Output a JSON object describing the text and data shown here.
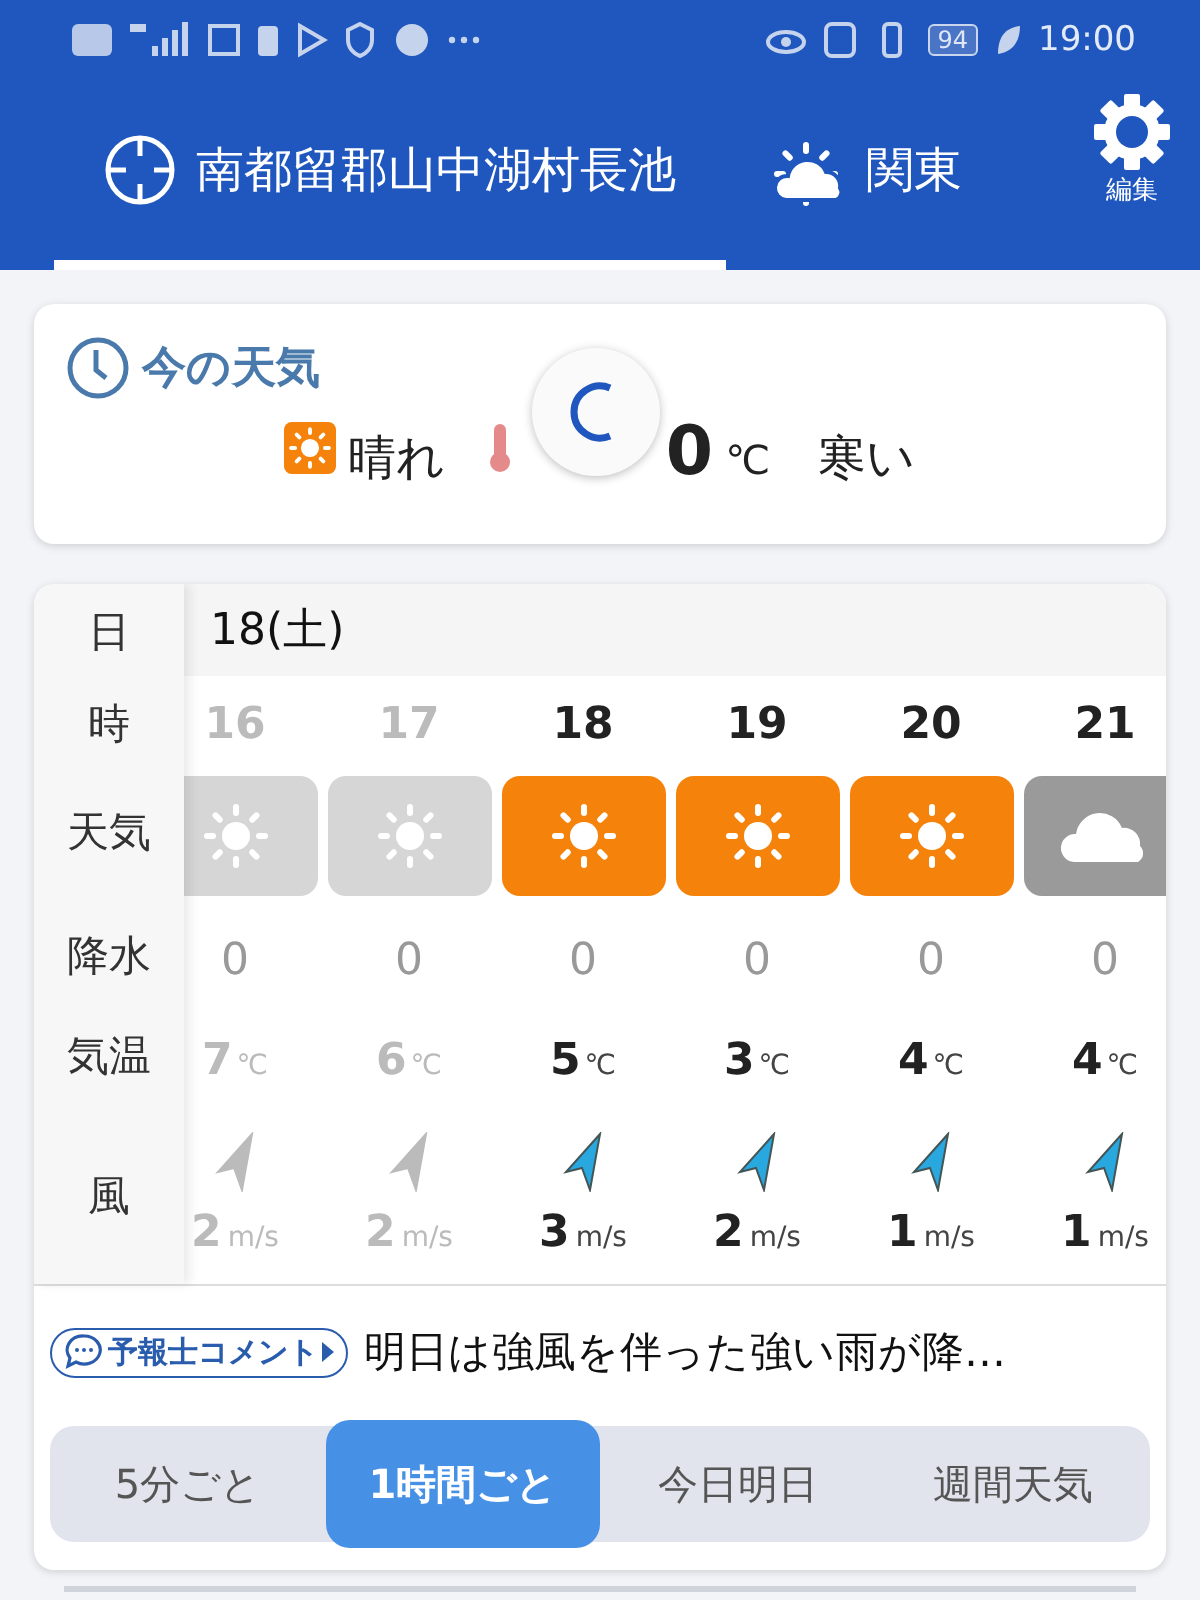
{
  "status_bar": {
    "battery": "94",
    "time": "19:00"
  },
  "header": {
    "tabs": [
      {
        "kind": "location",
        "label": "南都留郡山中湖村長池",
        "selected": true
      },
      {
        "kind": "region",
        "label": "関東",
        "selected": false
      }
    ],
    "settings_label": "編集"
  },
  "current": {
    "title": "今の天気",
    "condition": "晴れ",
    "temperature": "0",
    "unit": "℃",
    "feeling": "寒い",
    "loading": true
  },
  "hourly": {
    "row_labels": [
      "日",
      "時",
      "天気",
      "降水",
      "気温",
      "風"
    ],
    "date": "18(土)",
    "columns": [
      {
        "hour": "16",
        "past": true,
        "kind": "sunny",
        "precip": "0",
        "temp": "7",
        "temp_unit": "℃",
        "wind": "2",
        "wind_unit": "m/s"
      },
      {
        "hour": "17",
        "past": true,
        "kind": "sunny",
        "precip": "0",
        "temp": "6",
        "temp_unit": "℃",
        "wind": "2",
        "wind_unit": "m/s"
      },
      {
        "hour": "18",
        "past": false,
        "kind": "sunny",
        "precip": "0",
        "temp": "5",
        "temp_unit": "℃",
        "wind": "3",
        "wind_unit": "m/s"
      },
      {
        "hour": "19",
        "past": false,
        "kind": "sunny",
        "precip": "0",
        "temp": "3",
        "temp_unit": "℃",
        "wind": "2",
        "wind_unit": "m/s"
      },
      {
        "hour": "20",
        "past": false,
        "kind": "sunny",
        "precip": "0",
        "temp": "4",
        "temp_unit": "℃",
        "wind": "1",
        "wind_unit": "m/s"
      },
      {
        "hour": "21",
        "past": false,
        "kind": "cloudy",
        "precip": "0",
        "temp": "4",
        "temp_unit": "℃",
        "wind": "1",
        "wind_unit": "m/s"
      }
    ],
    "comment_badge": "予報士コメント",
    "comment": "明日は強風を伴った強い雨が降…"
  },
  "view_tabs": [
    {
      "label": "5分ごと",
      "selected": false
    },
    {
      "label": "1時間ごと",
      "selected": true
    },
    {
      "label": "今日明日",
      "selected": false
    },
    {
      "label": "週間天気",
      "selected": false
    }
  ]
}
